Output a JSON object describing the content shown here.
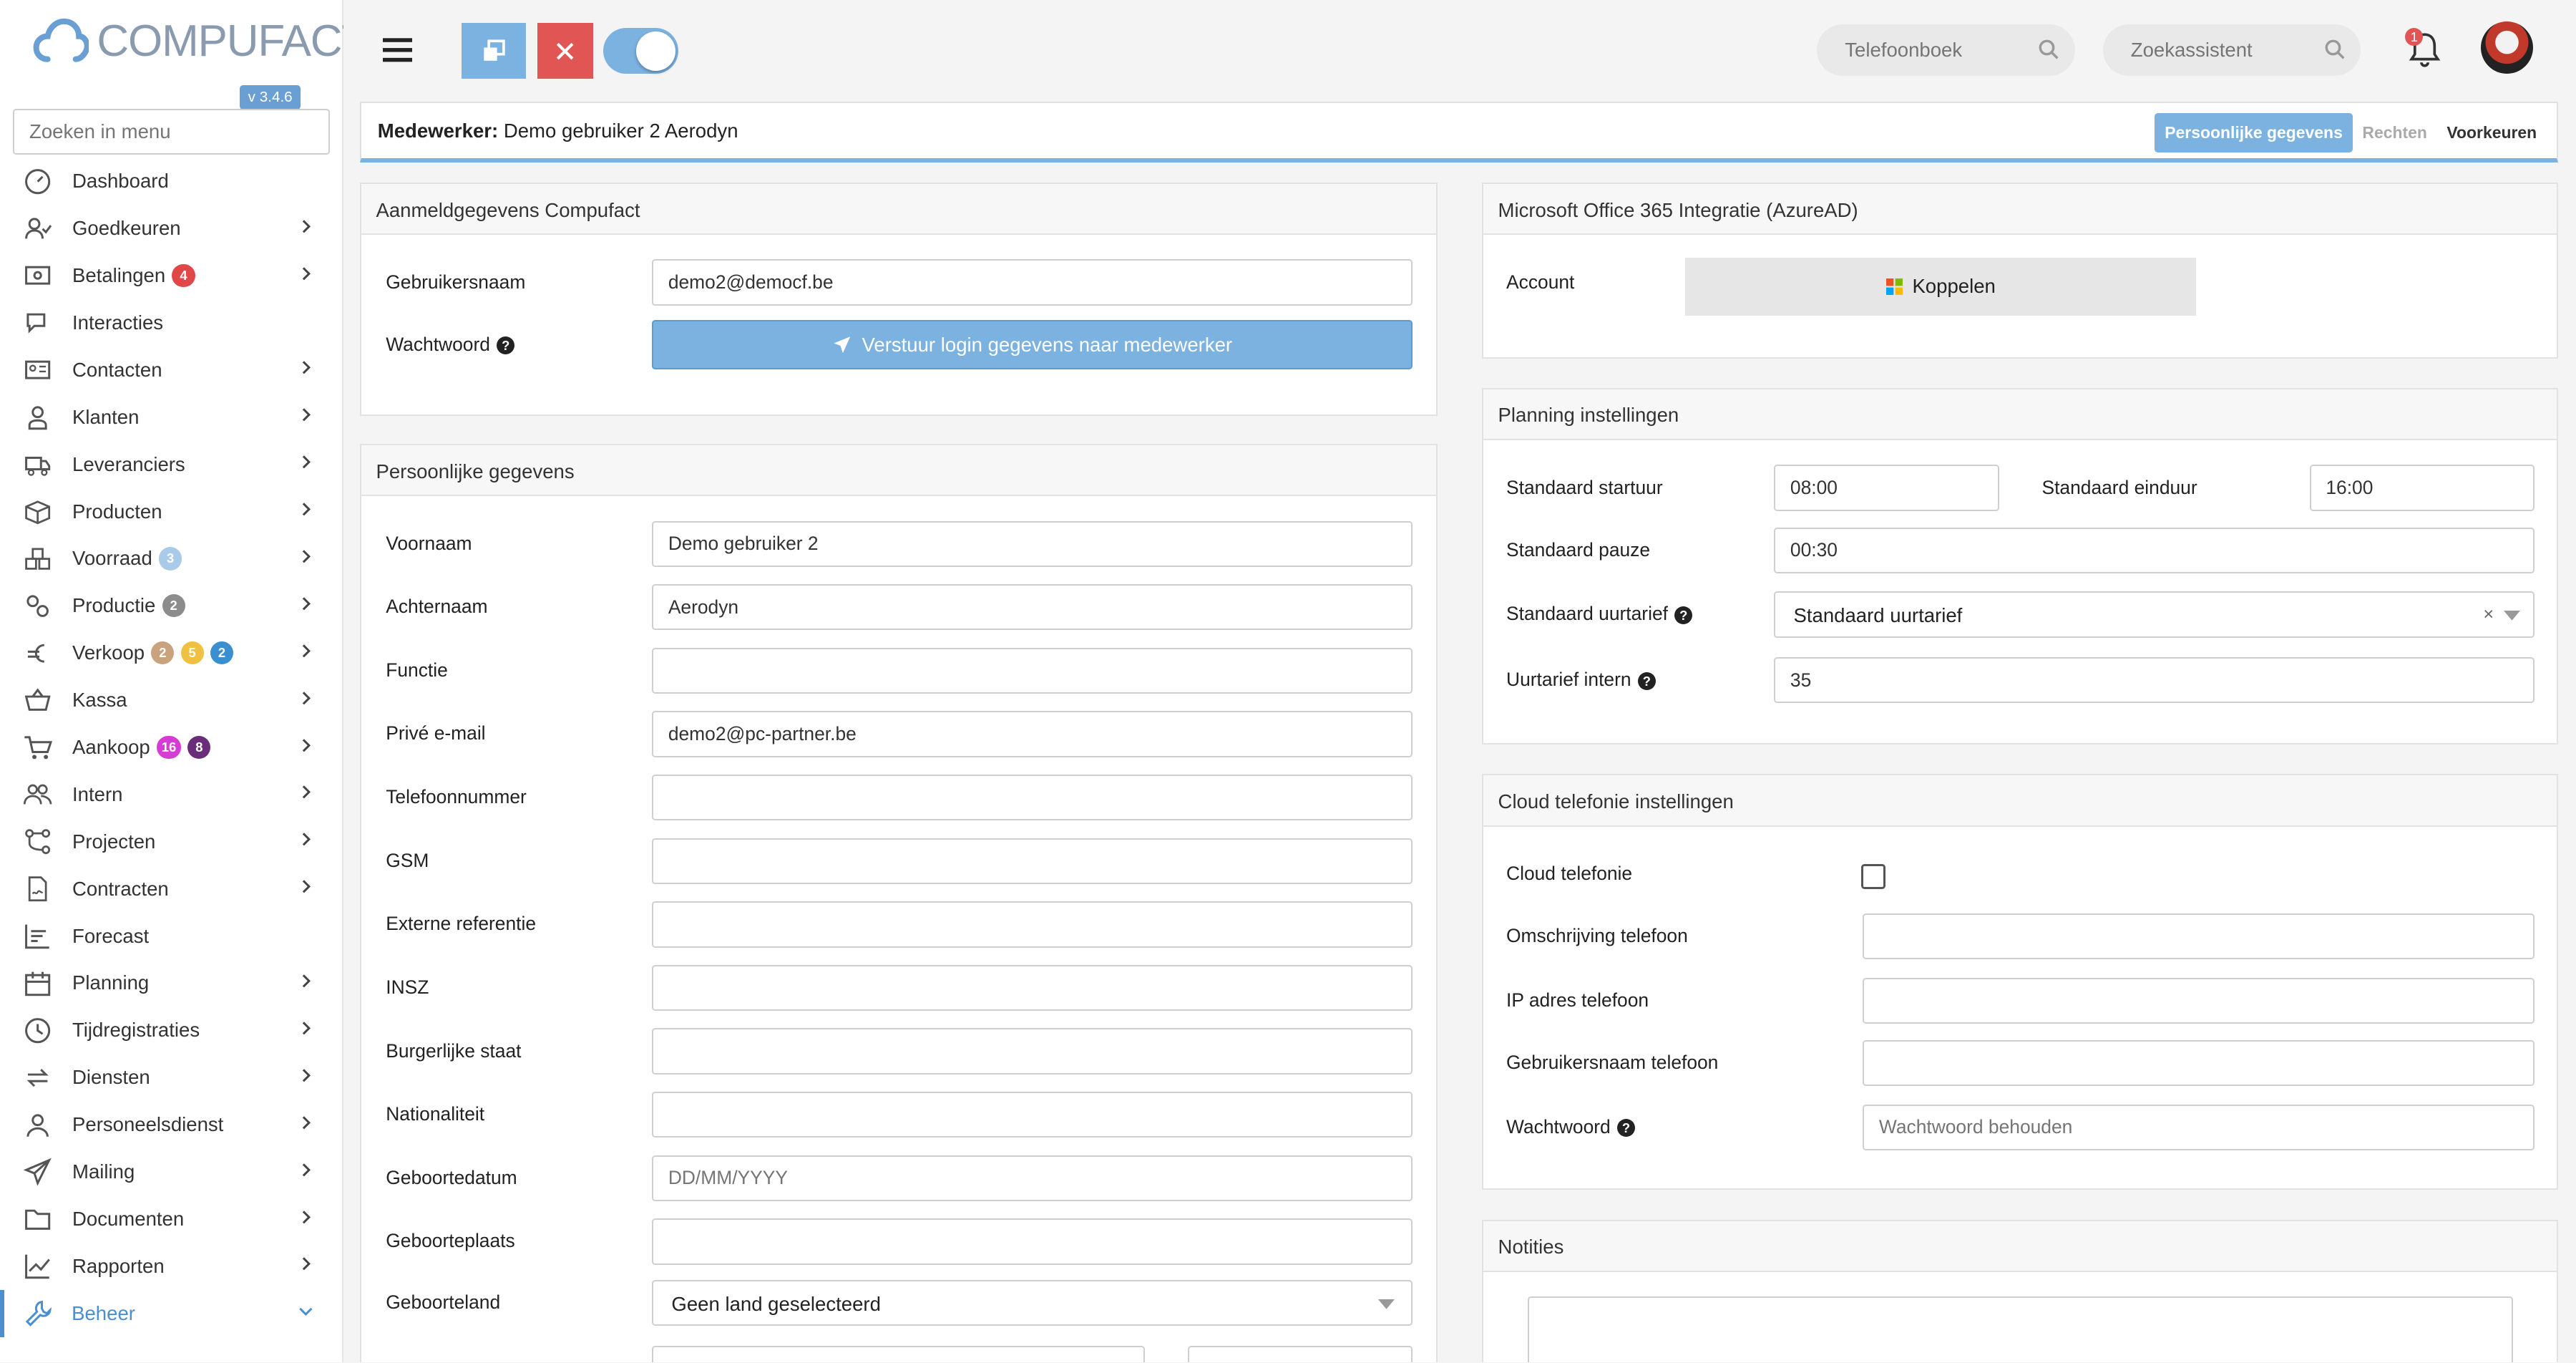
{
  "app": {
    "logo_text": "COMPUFACT",
    "version": "v 3.4.6",
    "menu_search_placeholder": "Zoeken in menu"
  },
  "sidebar": {
    "items": [
      {
        "label": "Dashboard",
        "icon": "dashboard-icon",
        "chevron": false
      },
      {
        "label": "Goedkeuren",
        "icon": "user-check-icon",
        "chevron": true
      },
      {
        "label": "Betalingen",
        "icon": "money-icon",
        "chevron": true,
        "badges": [
          {
            "text": "4",
            "color": "#e04848"
          }
        ]
      },
      {
        "label": "Interacties",
        "icon": "chat-icon",
        "chevron": false
      },
      {
        "label": "Contacten",
        "icon": "address-card-icon",
        "chevron": true
      },
      {
        "label": "Klanten",
        "icon": "customer-icon",
        "chevron": true
      },
      {
        "label": "Leveranciers",
        "icon": "truck-icon",
        "chevron": true
      },
      {
        "label": "Producten",
        "icon": "box-icon",
        "chevron": true
      },
      {
        "label": "Voorraad",
        "icon": "boxes-icon",
        "chevron": true,
        "badges": [
          {
            "text": "3",
            "color": "#a9cbe9"
          }
        ]
      },
      {
        "label": "Productie",
        "icon": "gears-icon",
        "chevron": true,
        "badges": [
          {
            "text": "2",
            "color": "#8c8c8c"
          }
        ]
      },
      {
        "label": "Verkoop",
        "icon": "euro-icon",
        "chevron": true,
        "badges": [
          {
            "text": "2",
            "color": "#c9a27e"
          },
          {
            "text": "5",
            "color": "#f0c040"
          },
          {
            "text": "2",
            "color": "#3a8fd0"
          }
        ]
      },
      {
        "label": "Kassa",
        "icon": "basket-icon",
        "chevron": true
      },
      {
        "label": "Aankoop",
        "icon": "cart-icon",
        "chevron": true,
        "badges": [
          {
            "text": "16",
            "color": "#d63bd6"
          },
          {
            "text": "8",
            "color": "#6a2d7a"
          }
        ]
      },
      {
        "label": "Intern",
        "icon": "users-icon",
        "chevron": true
      },
      {
        "label": "Projecten",
        "icon": "project-icon",
        "chevron": true
      },
      {
        "label": "Contracten",
        "icon": "contract-icon",
        "chevron": true
      },
      {
        "label": "Forecast",
        "icon": "bar-chart-icon",
        "chevron": false
      },
      {
        "label": "Planning",
        "icon": "calendar-icon",
        "chevron": true
      },
      {
        "label": "Tijdregistraties",
        "icon": "clock-icon",
        "chevron": true
      },
      {
        "label": "Diensten",
        "icon": "sync-icon",
        "chevron": true
      },
      {
        "label": "Personeelsdienst",
        "icon": "person-icon",
        "chevron": true
      },
      {
        "label": "Mailing",
        "icon": "paper-plane-icon",
        "chevron": true
      },
      {
        "label": "Documenten",
        "icon": "folder-icon",
        "chevron": true
      },
      {
        "label": "Rapporten",
        "icon": "line-chart-icon",
        "chevron": true
      },
      {
        "label": "Beheer",
        "icon": "wrench-icon",
        "chevron": true,
        "active": true
      }
    ]
  },
  "topbar": {
    "phonebook_placeholder": "Telefoonboek",
    "assistant_placeholder": "Zoekassistent",
    "notification_count": "1"
  },
  "titlebar": {
    "prefix": "Medewerker:",
    "name": "Demo gebruiker 2 Aerodyn",
    "tabs": [
      "Persoonlijke gegevens",
      "Rechten",
      "Voorkeuren"
    ]
  },
  "login": {
    "title": "Aanmeldgegevens Compufact",
    "username_label": "Gebruikersnaam",
    "username_value": "demo2@democf.be",
    "password_label": "Wachtwoord",
    "send_button": "Verstuur login gegevens naar medewerker"
  },
  "personal": {
    "title": "Persoonlijke gegevens",
    "fields": [
      {
        "label": "Voornaam",
        "value": "Demo gebruiker 2",
        "placeholder": ""
      },
      {
        "label": "Achternaam",
        "value": "Aerodyn",
        "placeholder": ""
      },
      {
        "label": "Functie",
        "value": "",
        "placeholder": ""
      },
      {
        "label": "Privé e-mail",
        "value": "demo2@pc-partner.be",
        "placeholder": ""
      },
      {
        "label": "Telefoonnummer",
        "value": "",
        "placeholder": ""
      },
      {
        "label": "GSM",
        "value": "",
        "placeholder": ""
      },
      {
        "label": "Externe referentie",
        "value": "",
        "placeholder": ""
      },
      {
        "label": "INSZ",
        "value": "",
        "placeholder": ""
      },
      {
        "label": "Burgerlijke staat",
        "value": "",
        "placeholder": ""
      },
      {
        "label": "Nationaliteit",
        "value": "",
        "placeholder": ""
      },
      {
        "label": "Geboortedatum",
        "value": "",
        "placeholder": "DD/MM/YYYY"
      },
      {
        "label": "Geboorteplaats",
        "value": "",
        "placeholder": ""
      }
    ],
    "country_label": "Geboorteland",
    "country_value": "Geen land geselecteerd"
  },
  "office": {
    "title": "Microsoft Office 365 Integratie (AzureAD)",
    "account_label": "Account",
    "link_button": "Koppelen"
  },
  "planning": {
    "title": "Planning instellingen",
    "start_label": "Standaard startuur",
    "start_value": "08:00",
    "end_label": "Standaard einduur",
    "end_value": "16:00",
    "pause_label": "Standaard pauze",
    "pause_value": "00:30",
    "rate_label": "Standaard uurtarief",
    "rate_value": "Standaard uurtarief",
    "internal_label": "Uurtarief intern",
    "internal_value": "35"
  },
  "cloud": {
    "title": "Cloud telefonie instellingen",
    "cloud_label": "Cloud telefonie",
    "desc_label": "Omschrijving telefoon",
    "ip_label": "IP adres telefoon",
    "user_label": "Gebruikersnaam telefoon",
    "pw_label": "Wachtwoord",
    "pw_placeholder": "Wachtwoord behouden"
  },
  "notes": {
    "title": "Notities"
  },
  "colors": {
    "accent": "#7cb2e0",
    "danger": "#e15555",
    "active": "#4a8fd0"
  }
}
